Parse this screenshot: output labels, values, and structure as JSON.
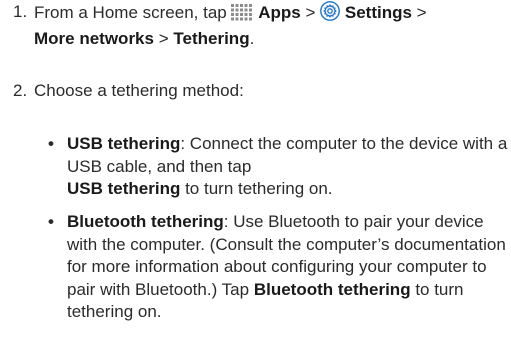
{
  "steps": [
    {
      "number": "1.",
      "prefix": "From a Home screen, tap",
      "apps_icon": "apps-grid-icon",
      "apps_label": "Apps",
      "sep1": ">",
      "settings_icon": "settings-gear-icon",
      "settings_label": "Settings",
      "sep2": ">",
      "more_networks": "More networks",
      "sep3": ">",
      "tethering": "Tethering",
      "end": "."
    },
    {
      "number": "2.",
      "text": "Choose a tethering method:"
    }
  ],
  "bullets": [
    {
      "marker": "•",
      "title": "USB tethering",
      "text_a": ": Connect the computer to the device with a USB cable, and then tap",
      "bold_b": "USB tethering",
      "text_c": "to turn tethering on."
    },
    {
      "marker": "•",
      "title": "Bluetooth tethering",
      "text_a": ": Use Bluetooth to pair your device with the computer. (Consult the computer’s documentation for more information about configuring your computer to pair with Bluetooth.) Tap",
      "bold_b": "Bluetooth tethering",
      "text_c": "to turn tethering on."
    }
  ],
  "colors": {
    "text": "#2b2b2b",
    "icon_gray": "#8c8c8c",
    "icon_blue": "#1e73c8"
  }
}
